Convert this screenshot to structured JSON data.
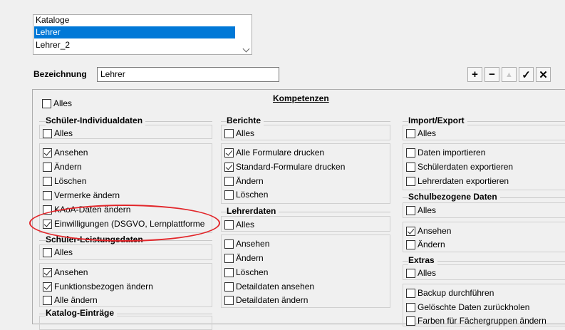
{
  "list": {
    "items": [
      {
        "label": "Kataloge",
        "selected": false
      },
      {
        "label": "Lehrer",
        "selected": true
      },
      {
        "label": "Lehrer_2",
        "selected": false
      }
    ]
  },
  "name_row": {
    "label": "Bezeichnung",
    "value": "Lehrer"
  },
  "toolbar": {
    "add": "+",
    "remove": "−",
    "up": "▲",
    "confirm": "✓",
    "cancel": "✕"
  },
  "panel": {
    "title": "Kompetenzen",
    "alles": "Alles"
  },
  "groups": {
    "schueler_individual": {
      "title": "Schüler-Individualdaten",
      "alles": "Alles",
      "items": [
        "Ansehen",
        "Ändern",
        "Löschen",
        "Vermerke ändern",
        "KAoA-Daten ändern",
        "Einwilligungen (DSGVO, Lernplattforme"
      ]
    },
    "schueler_leistung": {
      "title": "Schüler-Leistungsdaten",
      "alles": "Alles",
      "items": [
        "Ansehen",
        "Funktionsbezogen ändern",
        "Alle ändern"
      ]
    },
    "katalog": {
      "title": "Katalog-Einträge"
    },
    "berichte": {
      "title": "Berichte",
      "alles": "Alles",
      "items": [
        "Alle Formulare drucken",
        "Standard-Formulare drucken",
        "Ändern",
        "Löschen"
      ]
    },
    "lehrerdaten": {
      "title": "Lehrerdaten",
      "alles": "Alles",
      "items": [
        "Ansehen",
        "Ändern",
        "Löschen",
        "Detaildaten ansehen",
        "Detaildaten ändern"
      ]
    },
    "import_export": {
      "title": "Import/Export",
      "alles": "Alles",
      "items": [
        "Daten importieren",
        "Schülerdaten exportieren",
        "Lehrerdaten exportieren"
      ]
    },
    "schulbezogen": {
      "title": "Schulbezogene Daten",
      "alles": "Alles",
      "items": [
        "Ansehen",
        "Ändern"
      ]
    },
    "extras": {
      "title": "Extras",
      "alles": "Alles",
      "items": [
        "Backup durchführen",
        "Gelöschte Daten zurückholen",
        "Farben für Fächergruppen ändern"
      ]
    }
  }
}
